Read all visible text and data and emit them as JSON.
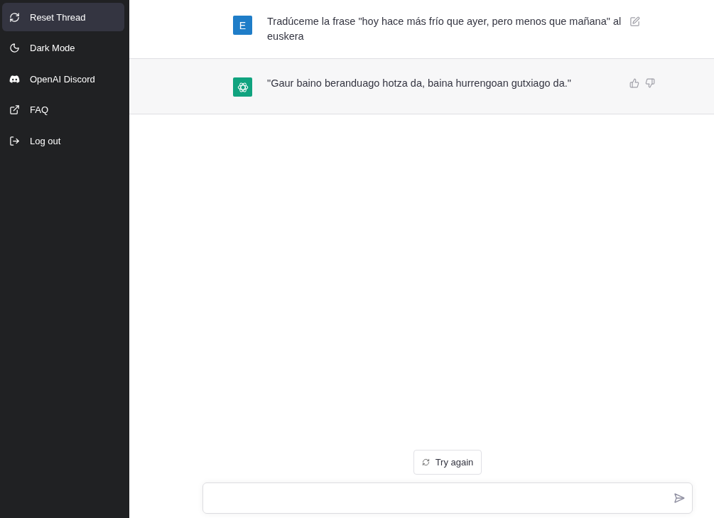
{
  "sidebar": {
    "items": [
      {
        "label": "Reset Thread",
        "kind": "refresh",
        "selected": true
      },
      {
        "label": "Dark Mode",
        "kind": "moon",
        "selected": false
      },
      {
        "label": "OpenAI Discord",
        "kind": "discord",
        "selected": false
      },
      {
        "label": "FAQ",
        "kind": "external",
        "selected": false
      },
      {
        "label": "Log out",
        "kind": "logout",
        "selected": false
      }
    ]
  },
  "messages": [
    {
      "kind": "user",
      "avatar_letter": "E",
      "text": "Tradúceme la frase \"hoy hace más frío que ayer, pero menos que mañana\" al euskera"
    },
    {
      "kind": "assistant",
      "text": "\"Gaur baino beranduago hotza da, baina hurrengoan gutxiago da.\""
    }
  ],
  "try_again_button": "Try again"
}
